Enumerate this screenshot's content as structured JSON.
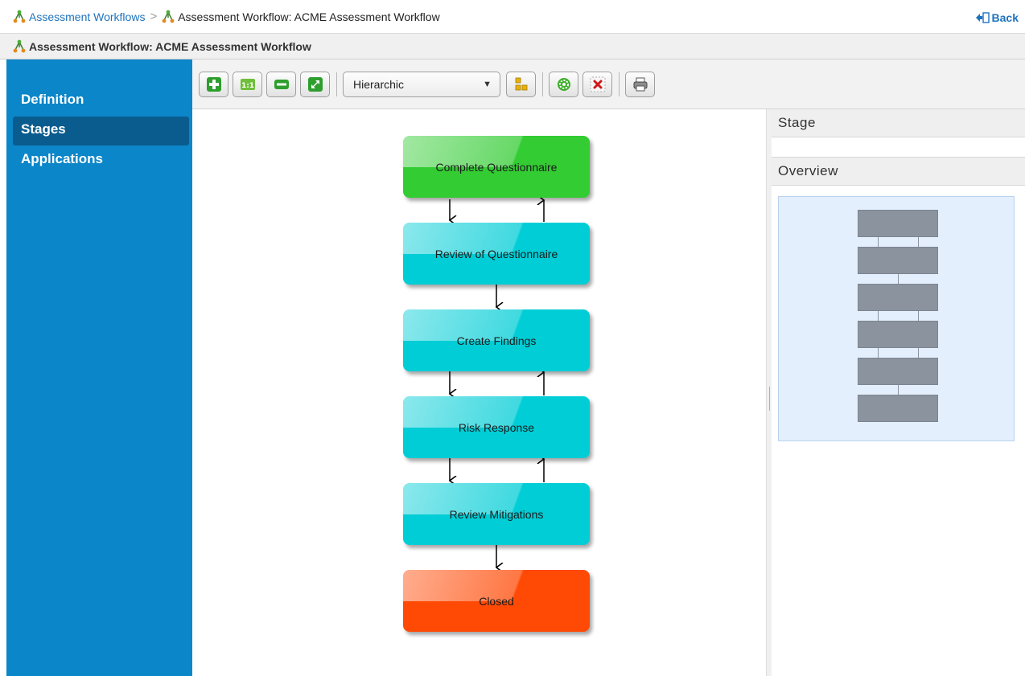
{
  "breadcrumb": {
    "parent_label": "Assessment Workflows",
    "separator": ">",
    "current_label": "Assessment Workflow: ACME Assessment Workflow",
    "back_label": "Back"
  },
  "title": "Assessment Workflow: ACME Assessment Workflow",
  "nav": {
    "items": [
      {
        "label": "Definition",
        "active": false
      },
      {
        "label": "Stages",
        "active": true
      },
      {
        "label": "Applications",
        "active": false
      }
    ]
  },
  "toolbar": {
    "layout_select_value": "Hierarchic",
    "buttons": [
      "zoom-in-icon",
      "actual-size-icon",
      "zoom-out-icon",
      "fit-icon",
      "arrange-icon",
      "settings-icon",
      "delete-icon",
      "print-icon"
    ]
  },
  "stages": [
    {
      "label": "Complete Questionnaire",
      "color": "#33cc33"
    },
    {
      "label": "Review of Questionnaire",
      "color": "#00cdd6"
    },
    {
      "label": "Create Findings",
      "color": "#00cdd6"
    },
    {
      "label": "Risk Response",
      "color": "#00cdd6"
    },
    {
      "label": "Review Mitigations",
      "color": "#00cdd6"
    },
    {
      "label": "Closed",
      "color": "#ff4a06"
    }
  ],
  "right_panel": {
    "stage_header": "Stage",
    "overview_header": "Overview"
  },
  "colors": {
    "nav_bg": "#0b86c9",
    "nav_active": "#0a5c8e",
    "link": "#1e73be",
    "overview_bg": "#e3effc"
  }
}
